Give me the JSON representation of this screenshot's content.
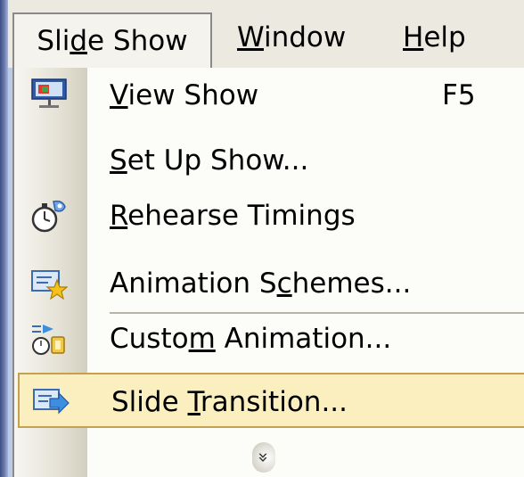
{
  "menubar": {
    "items": [
      {
        "label_pre": "Sli",
        "label_key": "d",
        "label_post": "e Show"
      },
      {
        "label_pre": "",
        "label_key": "W",
        "label_post": "indow"
      },
      {
        "label_pre": "",
        "label_key": "H",
        "label_post": "elp"
      }
    ]
  },
  "menu": {
    "items": [
      {
        "pre": "",
        "key": "V",
        "post": "iew Show",
        "shortcut": "F5",
        "icon": "projector-screen-icon"
      },
      {
        "pre": "",
        "key": "S",
        "post": "et Up Show...",
        "shortcut": "",
        "icon": ""
      },
      {
        "pre": "",
        "key": "R",
        "post": "ehearse Timings",
        "shortcut": "",
        "icon": "stopwatch-icon"
      },
      {
        "pre": "Animation S",
        "key": "c",
        "post": "hemes...",
        "shortcut": "",
        "icon": "animation-schemes-star-icon"
      },
      {
        "pre": "Custo",
        "key": "m",
        "post": " Animation...",
        "shortcut": "",
        "icon": "custom-animation-icon"
      },
      {
        "pre": "Slide ",
        "key": "T",
        "post": "ransition...",
        "shortcut": "",
        "icon": "slide-transition-icon"
      }
    ],
    "expand_glyph": "»",
    "highlighted_index": 5
  },
  "colors": {
    "menubar_bg": "#eceae0",
    "menu_bg": "#fcfcf9",
    "highlight_bg": "#fbefc0",
    "highlight_border": "#c5a14e"
  }
}
